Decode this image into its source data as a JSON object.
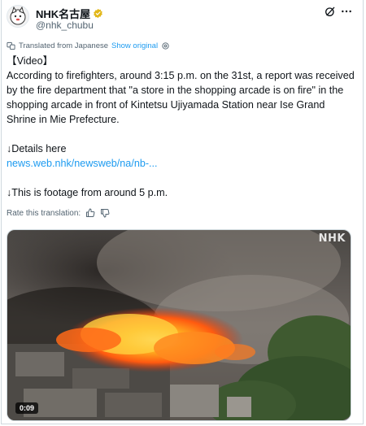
{
  "account": {
    "display_name": "NHK名古屋",
    "handle": "@nhk_chubu",
    "verified_badge_color": "#e2b719"
  },
  "header_icons": [
    "grok-icon",
    "more-icon"
  ],
  "translation": {
    "label": "Translated from Japanese",
    "show_original": "Show original"
  },
  "post": {
    "line1": "【Video】",
    "line2": "According to firefighters, around 3:15 p.m. on the 31st, a report was received by the fire department that \"a store in the shopping arcade is on fire\" in the shopping arcade in front of Kintetsu Ujiyamada Station near Ise Grand Shrine in Mie Prefecture.",
    "details_label": "↓Details here",
    "link": "news.web.nhk/newsweb/na/nb-...",
    "footage_note": "↓This is footage from around 5 p.m."
  },
  "rate": {
    "label": "Rate this translation:"
  },
  "media": {
    "watermark": "NHK",
    "duration": "0:09"
  },
  "colors": {
    "link": "#1d9bf0",
    "secondary_text": "#536471",
    "text": "#0f1419"
  }
}
